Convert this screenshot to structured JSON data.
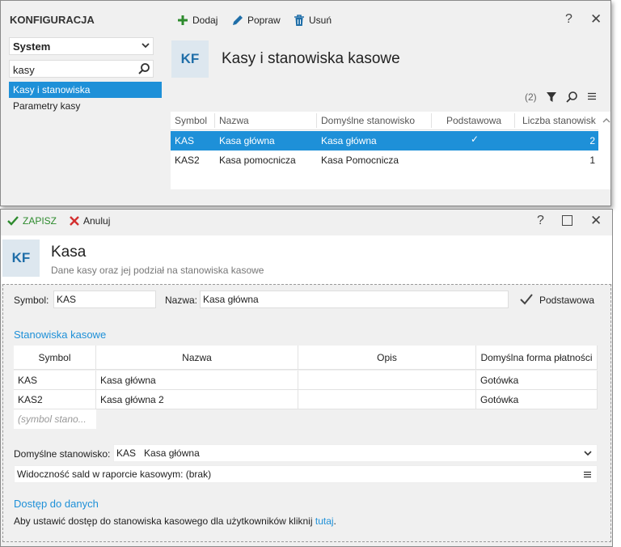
{
  "top_window": {
    "title": "KONFIGURACJA",
    "system_select": {
      "value": "System"
    },
    "search": {
      "value": "kasy"
    },
    "nav": [
      {
        "label": "Kasy i stanowiska",
        "selected": true
      },
      {
        "label": "Parametry kasy",
        "selected": false
      }
    ],
    "toolbar": {
      "add": "Dodaj",
      "edit": "Popraw",
      "delete": "Usuń"
    },
    "help": "?",
    "close": "✕",
    "badge": "KF",
    "heading": "Kasy i stanowiska kasowe",
    "count": "(2)",
    "grid": {
      "columns": [
        "Symbol",
        "Nazwa",
        "Domyślne stanowisko",
        "Podstawowa",
        "Liczba stanowisk"
      ],
      "rows": [
        {
          "symbol": "KAS",
          "nazwa": "Kasa główna",
          "domyslne": "Kasa główna",
          "podstawowa": "✓",
          "liczba": "2",
          "selected": true
        },
        {
          "symbol": "KAS2",
          "nazwa": "Kasa pomocnicza",
          "domyslne": "Kasa Pomocnicza",
          "podstawowa": "",
          "liczba": "1",
          "selected": false
        }
      ]
    }
  },
  "bottom_window": {
    "toolbar": {
      "save": "ZAPISZ",
      "cancel": "Anuluj"
    },
    "help": "?",
    "maximize": "☐",
    "close": "✕",
    "badge": "KF",
    "heading": "Kasa",
    "subheading": "Dane kasy oraz jej podział na stanowiska kasowe",
    "symbol_label": "Symbol:",
    "symbol_value": "KAS",
    "name_label": "Nazwa:",
    "name_value": "Kasa główna",
    "primary_label": "Podstawowa",
    "section_stations": "Stanowiska kasowe",
    "stations_grid": {
      "columns": [
        "Symbol",
        "Nazwa",
        "Opis",
        "Domyślna forma płatności"
      ],
      "rows": [
        {
          "symbol": "KAS",
          "nazwa": "Kasa główna",
          "opis": "",
          "forma": "Gotówka"
        },
        {
          "symbol": "KAS2",
          "nazwa": "Kasa główna 2",
          "opis": "",
          "forma": "Gotówka"
        }
      ],
      "new_row_placeholder": "(symbol stano..."
    },
    "default_station_label": "Domyślne stanowisko:",
    "default_station_symbol": "KAS",
    "default_station_name": "Kasa główna",
    "visibility_label": "Widoczność sald w raporcie kasowym: (brak)",
    "section_access": "Dostęp do danych",
    "access_text": "Aby ustawić dostęp do stanowiska kasowego dla użytkowników kliknij ",
    "access_link": "tutaj",
    "access_suffix": "."
  },
  "colors": {
    "accent": "#1e90d8",
    "badge_bg": "#dde7ef",
    "save_green": "#2e8b2e",
    "cancel_red": "#d32f2f"
  }
}
